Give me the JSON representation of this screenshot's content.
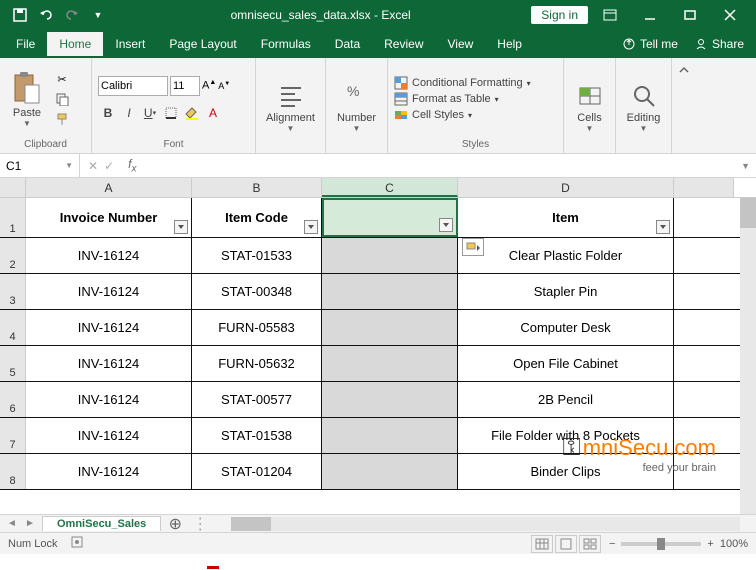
{
  "titlebar": {
    "title": "omnisecu_sales_data.xlsx - Excel",
    "signin": "Sign in"
  },
  "tabs": [
    "File",
    "Home",
    "Insert",
    "Page Layout",
    "Formulas",
    "Data",
    "Review",
    "View",
    "Help"
  ],
  "active_tab": "Home",
  "tellme": "Tell me",
  "share": "Share",
  "ribbon": {
    "clipboard": "Clipboard",
    "paste": "Paste",
    "font": "Font",
    "font_name": "Calibri",
    "font_size": "11",
    "alignment": "Alignment",
    "number": "Number",
    "cond_fmt": "Conditional Formatting",
    "fmt_table": "Format as Table",
    "cell_styles": "Cell Styles",
    "styles": "Styles",
    "cells": "Cells",
    "editing": "Editing"
  },
  "namebox": "C1",
  "columns": [
    "A",
    "B",
    "C",
    "D"
  ],
  "headers": {
    "A": "Invoice Number",
    "B": "Item Code",
    "C": "",
    "D": "Item"
  },
  "rows": [
    {
      "n": "2",
      "A": "INV-16124",
      "B": "STAT-01533",
      "C": "",
      "D": "Clear Plastic Folder"
    },
    {
      "n": "3",
      "A": "INV-16124",
      "B": "STAT-00348",
      "C": "",
      "D": "Stapler Pin"
    },
    {
      "n": "4",
      "A": "INV-16124",
      "B": "FURN-05583",
      "C": "",
      "D": "Computer Desk"
    },
    {
      "n": "5",
      "A": "INV-16124",
      "B": "FURN-05632",
      "C": "",
      "D": "Open File Cabinet"
    },
    {
      "n": "6",
      "A": "INV-16124",
      "B": "STAT-00577",
      "C": "",
      "D": "2B Pencil"
    },
    {
      "n": "7",
      "A": "INV-16124",
      "B": "STAT-01538",
      "C": "",
      "D": "File Folder with 8 Pockets"
    },
    {
      "n": "8",
      "A": "INV-16124",
      "B": "STAT-01204",
      "C": "",
      "D": "Binder Clips"
    }
  ],
  "sheet_tab": "OmniSecu_Sales",
  "status": {
    "numlock": "Num Lock",
    "zoom": "100%"
  },
  "watermark": {
    "main": "mniSecu.com",
    "sub": "feed your brain"
  }
}
